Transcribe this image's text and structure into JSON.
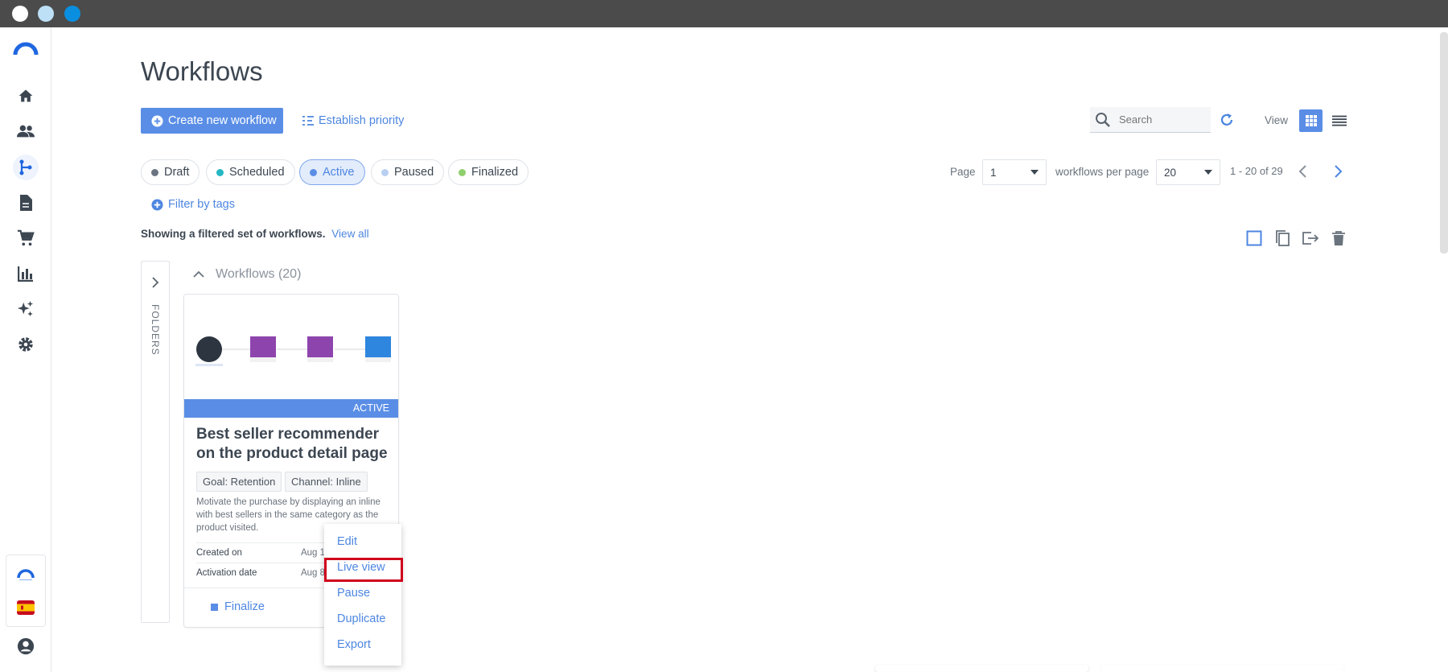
{
  "window": {
    "dots": [
      {
        "name": "window-close-dot",
        "color": "#ffffff"
      },
      {
        "name": "window-minimize-dot",
        "color": "#bde0f7"
      },
      {
        "name": "window-maximize-dot",
        "color": "#0a8fe0"
      }
    ]
  },
  "sidebar": {
    "items": [
      {
        "name": "home-icon"
      },
      {
        "name": "users-icon"
      },
      {
        "name": "workflows-icon",
        "active": true
      },
      {
        "name": "document-icon"
      },
      {
        "name": "cart-icon"
      },
      {
        "name": "chart-icon"
      },
      {
        "name": "sparkle-icon"
      },
      {
        "name": "gear-icon"
      }
    ],
    "bottom": [
      "brand-logo-icon",
      "flag-spain-icon",
      "user-account-icon"
    ]
  },
  "page": {
    "title": "Workflows",
    "create_button": "Create new workflow",
    "priority_link": "Establish priority",
    "search_placeholder": "Search",
    "view_label": "View"
  },
  "filters": {
    "chips": [
      {
        "label": "Draft",
        "color": "#6b7482",
        "active": false
      },
      {
        "label": "Scheduled",
        "color": "#26b7c4",
        "active": false
      },
      {
        "label": "Active",
        "color": "#5a8ee6",
        "active": true
      },
      {
        "label": "Paused",
        "color": "#b8cff2",
        "active": false
      },
      {
        "label": "Finalized",
        "color": "#8fcf6d",
        "active": false
      }
    ],
    "filter_tags": "Filter by tags",
    "showing_text": "Showing a filtered set of workflows.",
    "view_all": "View all"
  },
  "pagination": {
    "page_label": "Page",
    "page_value": "1",
    "per_page_label": "workflows per page",
    "per_page_value": "20",
    "range": "1 - 20 of 29"
  },
  "folders": {
    "label": "FOLDERS"
  },
  "group": {
    "title": "Workflows (20)"
  },
  "card": {
    "status": "ACTIVE",
    "title": "Best seller recommender on the product detail page",
    "tags": [
      "Goal: Retention",
      "Channel: Inline"
    ],
    "description": "Motivate the purchase by displaying an inline with best sellers in the same category as the product visited.",
    "meta": [
      {
        "label": "Created on",
        "value": "Aug 1"
      },
      {
        "label": "Activation date",
        "value": "Aug 8"
      }
    ],
    "footer_action": "Finalize"
  },
  "context_menu": {
    "items": [
      "Edit",
      "Live view",
      "Pause",
      "Duplicate",
      "Export"
    ],
    "highlighted": "Live view",
    "highlight_color": "#d0021b"
  },
  "colors": {
    "accent": "#5a8ee6",
    "link": "#4d86e0",
    "titlebar": "#4b4b4b"
  }
}
